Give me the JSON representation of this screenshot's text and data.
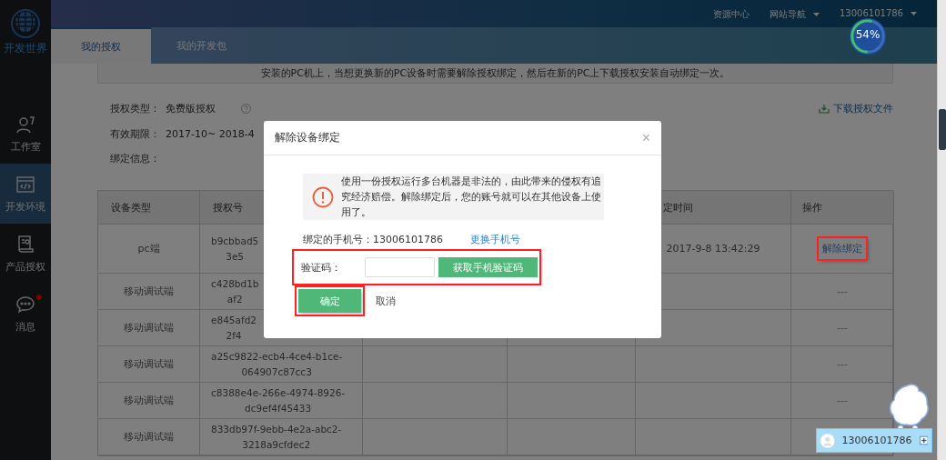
{
  "sidebar": {
    "logo": "开发世界",
    "items": [
      {
        "label": "工作室",
        "selected": false,
        "badge": false
      },
      {
        "label": "开发环境",
        "selected": true,
        "badge": false
      },
      {
        "label": "产品授权",
        "selected": false,
        "badge": false
      },
      {
        "label": "消息",
        "selected": false,
        "badge": true
      }
    ]
  },
  "header": {
    "links": [
      {
        "label": "资源中心",
        "dropdown": false
      },
      {
        "label": "网站导航",
        "dropdown": true
      },
      {
        "label": "13006101786",
        "dropdown": true
      }
    ]
  },
  "progress": {
    "level": 0.54,
    "reading": "54%"
  },
  "tabs": [
    {
      "label": "我的授权",
      "selected": true
    },
    {
      "label": "我的开发包",
      "selected": false
    }
  ],
  "notice": "安装的PC机上，当想更换新的PC设备时需要解除授权绑定，然后在新的PC上下载授权安装自动绑定一次。",
  "info": {
    "type_label": "授权类型：",
    "type_value": "免费版授权",
    "download": "下载授权文件",
    "period_label": "有效期限：",
    "period_value": "2017-10~ 2018-4",
    "binding_label": "绑定信息："
  },
  "table": {
    "columns": [
      "设备类型",
      "授权号",
      "定时间",
      "操作"
    ],
    "rows": [
      {
        "device": "pc端",
        "license": "b9cbbad5\n3e5",
        "time": "2017-9-8 13:42:29",
        "action": "解除绑定",
        "kind": "link",
        "highlighted": true
      },
      {
        "device": "移动调试端",
        "license": "c428bd1b\naf2",
        "action": "---",
        "kind": "text"
      },
      {
        "device": "移动调试端",
        "license": "e845afd2\n2f4",
        "action": "---",
        "kind": "text"
      },
      {
        "device": "移动调试端",
        "license": "a25c9822-ecb4-4ce4-b1ce-\n064907c87cc3",
        "action": "---",
        "kind": "text"
      },
      {
        "device": "移动调试端",
        "license": "c8388e4e-266e-4974-8926-\ndc9ef4f45433",
        "action": "---",
        "kind": "text"
      },
      {
        "device": "移动调试端",
        "license": "833db97f-9ebb-4e2a-abc2-\n3218a9cfdec2"
      }
    ]
  },
  "modal": {
    "title": "解除设备绑定",
    "close": "×",
    "warning": "使用一份授权运行多台机器是非法的，由此带来的侵权有追究经济赔偿。解除绑定后，您的账号就可以在其他设备上使用了。",
    "phone_label": "绑定的手机号：13006101786",
    "change_phone": "更换手机号",
    "code_label": "验证码：",
    "code_highlighted": true,
    "get_code": "获取手机验证码",
    "confirm": "确定",
    "confirm_highlighted": true,
    "cancel": "取消"
  },
  "chat": {
    "user": "13006101786"
  }
}
